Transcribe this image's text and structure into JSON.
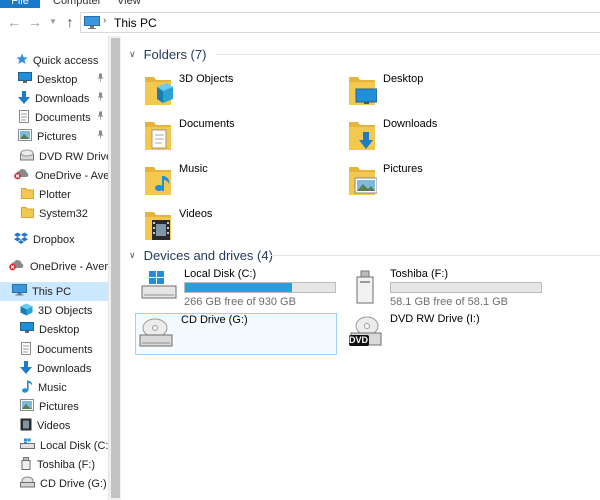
{
  "ribbon": {
    "tabs": [
      "File",
      "Computer",
      "View"
    ]
  },
  "address": {
    "location": "This PC"
  },
  "nav": {
    "items": [
      {
        "label": "Quick access",
        "icon": "star-icon",
        "pinned": false
      },
      {
        "label": "Desktop",
        "icon": "desktop-icon",
        "pinned": true
      },
      {
        "label": "Downloads",
        "icon": "download-icon",
        "pinned": true
      },
      {
        "label": "Documents",
        "icon": "documents-icon",
        "pinned": true
      },
      {
        "label": "Pictures",
        "icon": "pictures-icon",
        "pinned": true
      },
      {
        "label": "DVD RW Drive (I:",
        "icon": "dvd-drive-icon",
        "pinned": false
      },
      {
        "label": "OneDrive - Averd",
        "icon": "onedrive-icon",
        "pinned": false
      },
      {
        "label": "Plotter",
        "icon": "folder-icon",
        "pinned": false
      },
      {
        "label": "System32",
        "icon": "folder-icon",
        "pinned": false
      },
      {
        "label": "Dropbox",
        "icon": "dropbox-icon",
        "pinned": false
      },
      {
        "label": "OneDrive - Averda",
        "icon": "onedrive-icon",
        "pinned": false
      },
      {
        "label": "This PC",
        "icon": "computer-icon",
        "pinned": false
      },
      {
        "label": "3D Objects",
        "icon": "3d-objects-icon",
        "pinned": false
      },
      {
        "label": "Desktop",
        "icon": "desktop-icon",
        "pinned": false
      },
      {
        "label": "Documents",
        "icon": "documents-icon",
        "pinned": false
      },
      {
        "label": "Downloads",
        "icon": "download-icon",
        "pinned": false
      },
      {
        "label": "Music",
        "icon": "music-icon",
        "pinned": false
      },
      {
        "label": "Pictures",
        "icon": "pictures-icon",
        "pinned": false
      },
      {
        "label": "Videos",
        "icon": "videos-icon",
        "pinned": false
      },
      {
        "label": "Local Disk (C:)",
        "icon": "local-disk-icon",
        "pinned": false
      },
      {
        "label": "Toshiba (F:)",
        "icon": "usb-drive-icon",
        "pinned": false
      },
      {
        "label": "CD Drive (G:)",
        "icon": "cd-drive-icon",
        "pinned": false
      }
    ]
  },
  "folders": {
    "header": "Folders (7)",
    "items": [
      {
        "label": "3D Objects",
        "icon": "3d-objects-folder-icon"
      },
      {
        "label": "Desktop",
        "icon": "desktop-folder-icon"
      },
      {
        "label": "Documents",
        "icon": "documents-folder-icon"
      },
      {
        "label": "Downloads",
        "icon": "downloads-folder-icon"
      },
      {
        "label": "Music",
        "icon": "music-folder-icon"
      },
      {
        "label": "Pictures",
        "icon": "pictures-folder-icon"
      },
      {
        "label": "Videos",
        "icon": "videos-folder-icon"
      }
    ]
  },
  "devices": {
    "header": "Devices and drives (4)",
    "items": [
      {
        "label": "Local Disk (C:)",
        "free": "266 GB free of 930 GB",
        "used_fraction": 0.71,
        "icon": "local-disk-icon"
      },
      {
        "label": "Toshiba (F:)",
        "free": "58.1 GB free of 58.1 GB",
        "used_fraction": 0.0,
        "icon": "usb-drive-icon"
      },
      {
        "label": "CD Drive (G:)",
        "icon": "cd-drive-icon"
      },
      {
        "label": "DVD RW Drive (I:)",
        "icon": "dvd-drive-icon",
        "badge": "DVD"
      }
    ]
  },
  "colors": {
    "selection": "#cce8ff",
    "accent": "#1979ca",
    "bar_fill": "#26a0da",
    "folder": "#f4c74f"
  }
}
